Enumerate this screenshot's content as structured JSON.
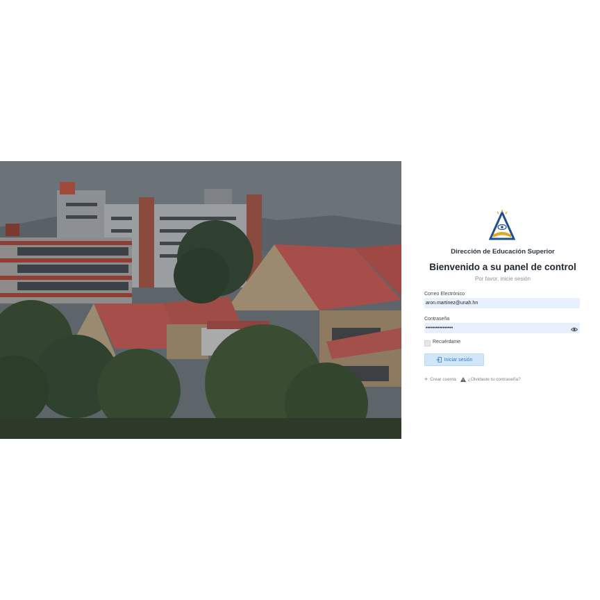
{
  "brand": {
    "org_name": "Dirección de Educación Superior",
    "logo_icon": "triangle-book-eye-logo",
    "accent": "#3a7bc8"
  },
  "login": {
    "title": "Bienvenido a su panel de control",
    "subtitle": "Por favor, inicie sesión",
    "email_label": "Correo Electrónico",
    "email_value": "aron.martinez@unah.hn",
    "password_label": "Contraseña",
    "password_value": "••••••••••••••••",
    "remember_label": "Recuérdame",
    "submit_label": "Iniciar sesión",
    "create_account_label": "Crear cuenta",
    "forgot_password_label": "¿Olvidaste tu contraseña?"
  },
  "hero": {
    "description_icon": "campus-photo"
  }
}
